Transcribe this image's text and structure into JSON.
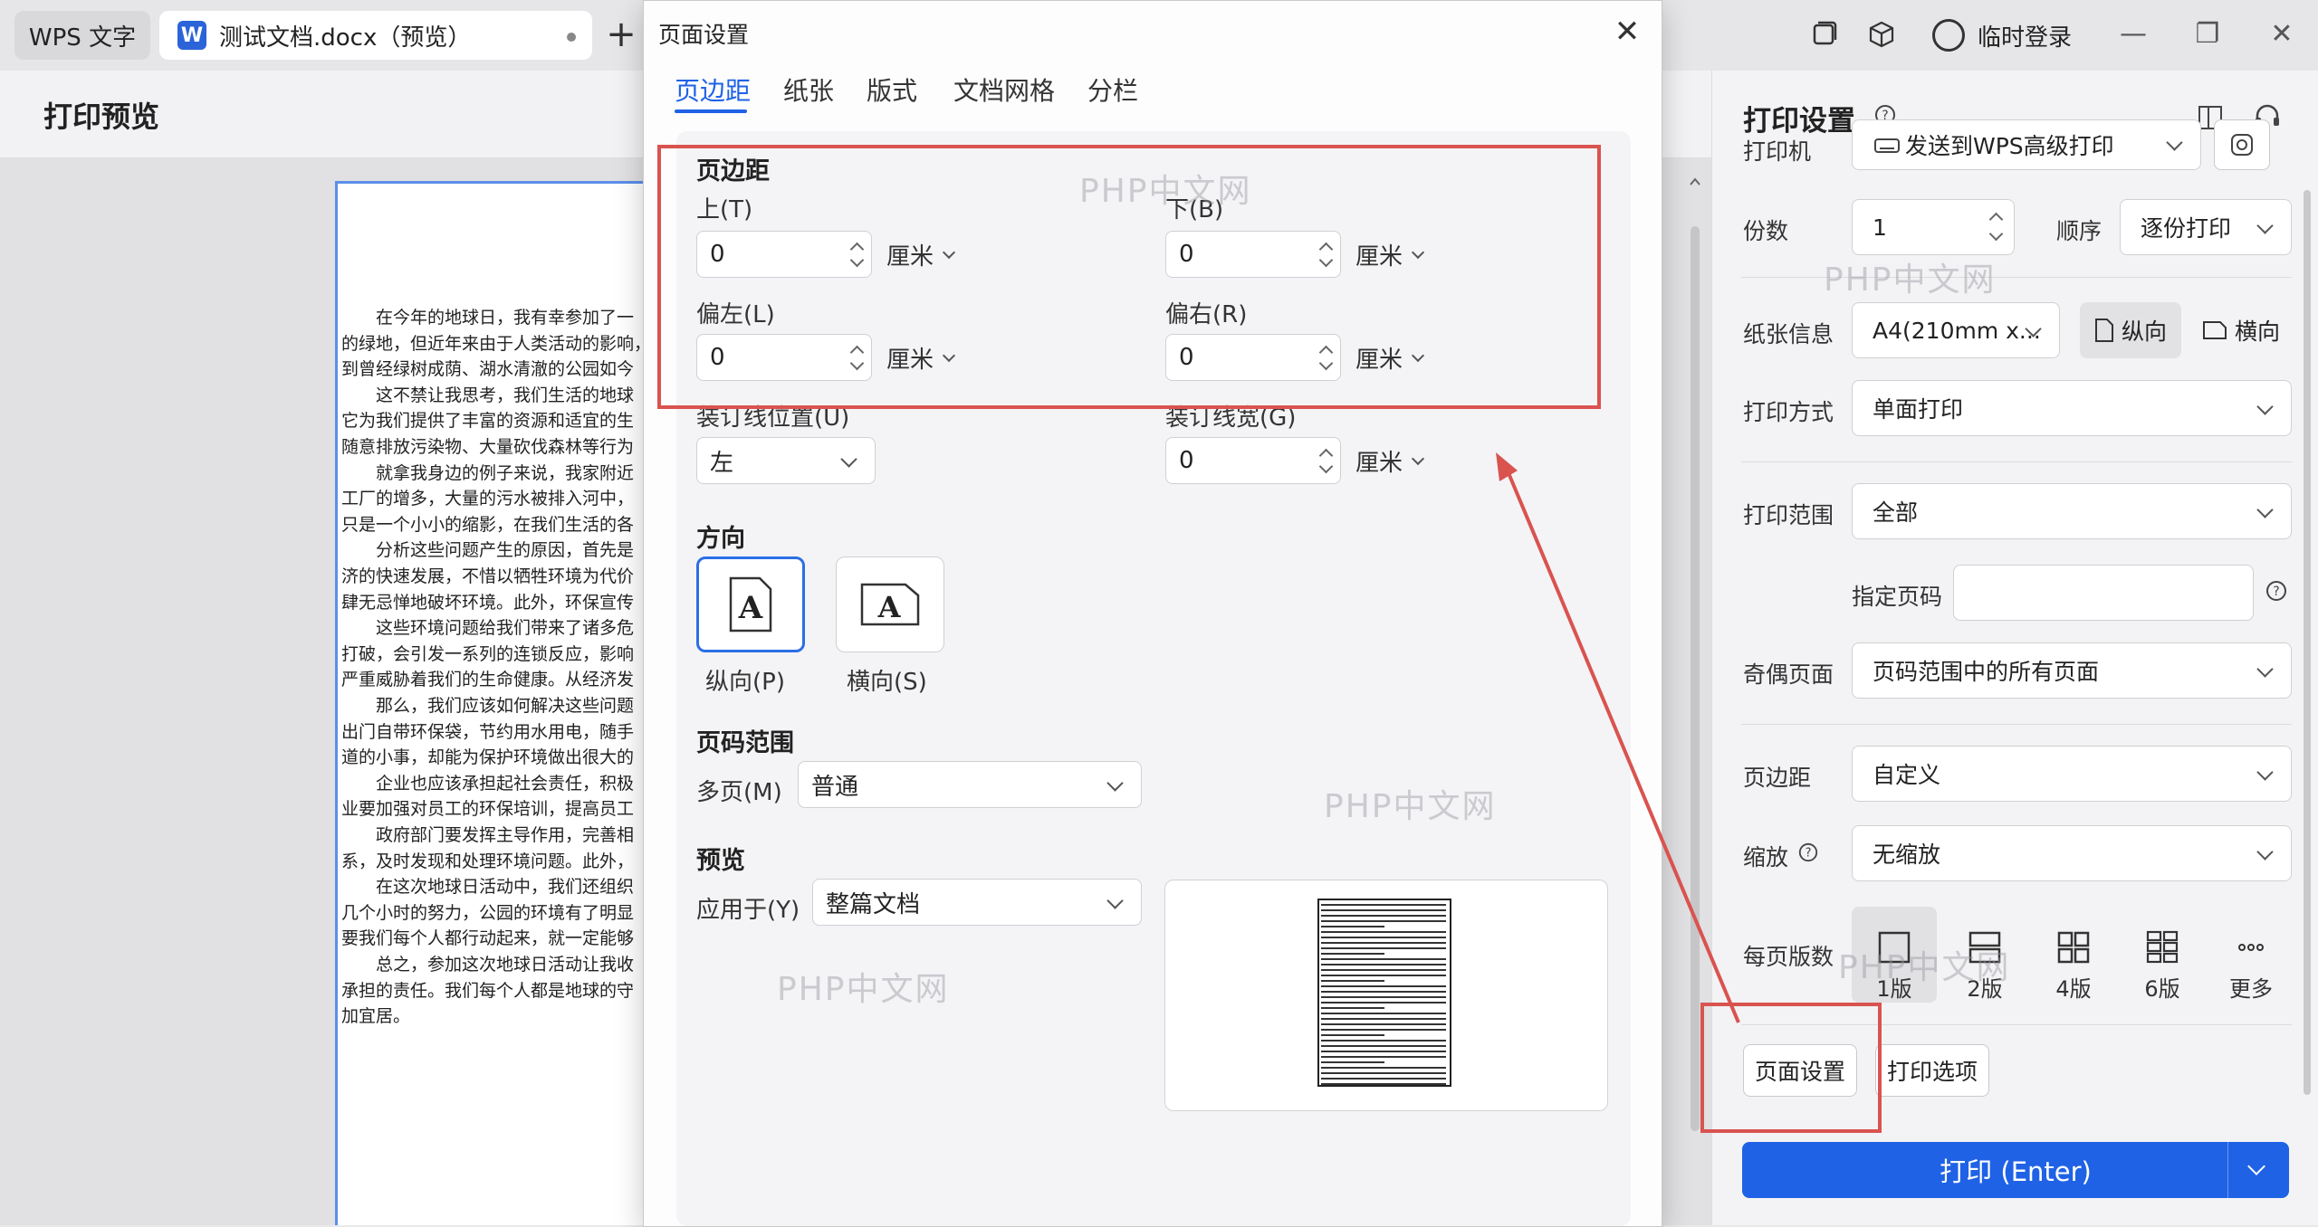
{
  "titlebar": {
    "app_tab": "WPS 文字",
    "doc_tab": "测试文档.docx（预览）",
    "doc_icon": "W",
    "new_tab": "+",
    "login": "临时登录"
  },
  "header": {
    "title": "打印预览"
  },
  "document": {
    "lines": [
      "　　在今年的地球日，我有幸参加了一",
      "的绿地，但近年来由于人类活动的影响，",
      "到曾经绿树成荫、湖水清澈的公园如今",
      "　　这不禁让我思考，我们生活的地球",
      "它为我们提供了丰富的资源和适宜的生",
      "随意排放污染物、大量砍伐森林等行为",
      "　　就拿我身边的例子来说，我家附近",
      "工厂的增多，大量的污水被排入河中，",
      "只是一个小小的缩影，在我们生活的各",
      "　　分析这些问题产生的原因，首先是",
      "济的快速发展，不惜以牺牲环境为代价",
      "肆无忌惮地破坏环境。此外，环保宣传",
      "　　这些环境问题给我们带来了诸多危",
      "打破，会引发一系列的连锁反应，影响",
      "严重威胁着我们的生命健康。从经济发",
      "　　那么，我们应该如何解决这些问题",
      "出门自带环保袋，节约用水用电，随手",
      "道的小事，却能为保护环境做出很大的",
      "　　企业也应该承担起社会责任，积极",
      "业要加强对员工的环保培训，提高员工",
      "　　政府部门要发挥主导作用，完善相",
      "系，及时发现和处理环境问题。此外，",
      "　　在这次地球日活动中，我们还组织",
      "几个小时的努力，公园的环境有了明显",
      "要我们每个人都行动起来，就一定能够",
      "　　总之，参加这次地球日活动让我收",
      "承担的责任。我们每个人都是地球的守",
      "加宜居。"
    ]
  },
  "dialog": {
    "title": "页面设置",
    "close": "✕",
    "tabs": [
      "页边距",
      "纸张",
      "版式",
      "文档网格",
      "分栏"
    ],
    "margins": {
      "section": "页边距",
      "top_label": "上(T)",
      "top_value": "0",
      "bottom_label": "下(B)",
      "bottom_value": "0",
      "left_label": "偏左(L)",
      "left_value": "0",
      "right_label": "偏右(R)",
      "right_value": "0",
      "unit": "厘米",
      "gutter_pos_label": "装订线位置(U)",
      "gutter_pos_value": "左",
      "gutter_width_label": "装订线宽(G)",
      "gutter_width_value": "0"
    },
    "orientation": {
      "section": "方向",
      "portrait": "纵向(P)",
      "landscape": "横向(S)",
      "glyph": "A"
    },
    "page_range": {
      "section": "页码范围",
      "multi_label": "多页(M)",
      "multi_value": "普通"
    },
    "preview": {
      "section": "预览",
      "apply_label": "应用于(Y)",
      "apply_value": "整篇文档"
    }
  },
  "panel": {
    "title": "打印设置",
    "printer_label": "打印机",
    "printer_value": "发送到WPS高级打印",
    "copies_label": "份数",
    "copies_value": "1",
    "order_label": "顺序",
    "order_value": "逐份打印",
    "paper_label": "纸张信息",
    "paper_value": "A4(210mm x...",
    "portrait": "纵向",
    "landscape": "横向",
    "mode_label": "打印方式",
    "mode_value": "单面打印",
    "range_label": "打印范围",
    "range_value": "全部",
    "pages_label": "指定页码",
    "pages_value": "",
    "oddeven_label": "奇偶页面",
    "oddeven_value": "页码范围中的所有页面",
    "margin_label": "页边距",
    "margin_value": "自定义",
    "zoom_label": "缩放",
    "zoom_value": "无缩放",
    "perpage_label": "每页版数",
    "layouts": [
      "1版",
      "2版",
      "4版",
      "6版",
      "更多"
    ],
    "page_setup_btn": "页面设置",
    "print_options_btn": "打印选项",
    "print_btn": "打印 (Enter)"
  },
  "watermarks": [
    "PHP中文网",
    "PHP中文网",
    "PHP中文网",
    "PHP中文网",
    "PHP中文网"
  ],
  "colors": {
    "accent": "#1f62e6",
    "annotation": "#d9534f"
  }
}
